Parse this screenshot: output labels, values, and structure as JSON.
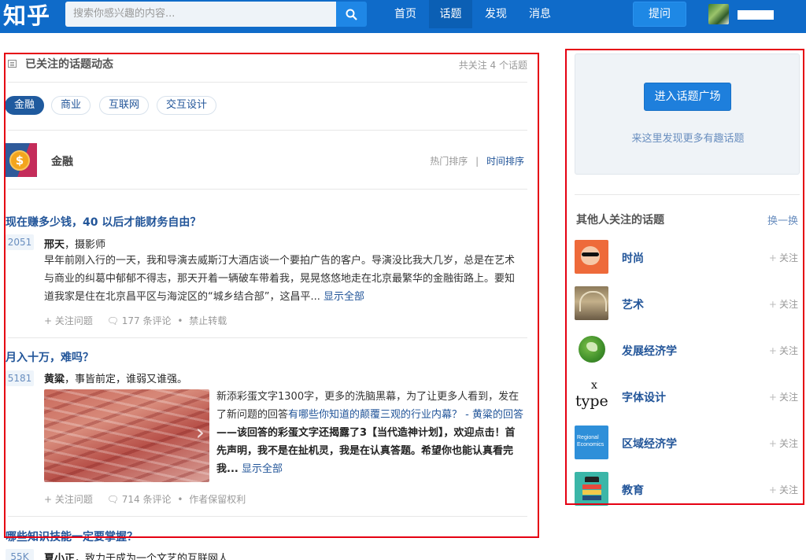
{
  "header": {
    "logo": "知乎",
    "search_placeholder": "搜索你感兴趣的内容...",
    "nav": [
      "首页",
      "话题",
      "发现",
      "消息"
    ],
    "active_nav": "话题",
    "ask_button": "提问"
  },
  "main": {
    "section_title": "已关注的话题动态",
    "followed_count": "共关注 4 个话题",
    "tags": [
      "金融",
      "商业",
      "互联网",
      "交互设计"
    ],
    "active_tag": "金融",
    "topic_name": "金融",
    "sort_hot": "热门排序",
    "sort_divider": "|",
    "sort_time": "时间排序",
    "feed": [
      {
        "title": "现在赚多少钱，40 以后才能财务自由？",
        "votes": "2051",
        "author_name": "邢天",
        "author_bio": "，摄影师",
        "body": "早年前刚入行的一天，我和导演去威斯汀大酒店谈一个要拍广告的客户。导演没比我大几岁，总是在艺术与商业的纠葛中郁郁不得志，那天开着一辆破车带着我，晃晃悠悠地走在北京最繁华的金融街路上。要知道我家是住在北京昌平区与海淀区的“城乡结合部”，这昌平...",
        "more": "显示全部",
        "meta_follow": "+ 关注问题",
        "meta_comments": "177 条评论",
        "meta_dot": "•",
        "meta_extra": "禁止转载"
      },
      {
        "title": "月入十万，难吗？",
        "votes": "5181",
        "author_name": "黄粱",
        "author_bio": "，事皆前定，谁弱又谁强。",
        "body_plain": "新添彩蛋文字1300字，更多的洗脑黑幕，为了让更多人看到，发在了新问题的回答",
        "body_link": "有哪些你知道的颠覆三观的行业内幕？ - 黄粱的回答",
        "body_bold": "——该回答的彩蛋文字还揭露了3【当代造神计划】，欢迎点击！首先声明，我不是在扯机灵，我是在认真答题。希望你也能认真看完我...",
        "more": "显示全部",
        "meta_follow": "+ 关注问题",
        "meta_comments": "714 条评论",
        "meta_dot": "•",
        "meta_extra": "作者保留权利"
      },
      {
        "title": "哪些知识技能一定要掌握？",
        "votes": "55K",
        "author_name": "夏小正",
        "author_bio": "，致力于成为一个文艺的互联网人"
      }
    ]
  },
  "sidebar": {
    "plaza_button": "进入话题广场",
    "plaza_tip": "来这里发现更多有趣话题",
    "others_title": "其他人关注的话题",
    "refresh": "换一换",
    "follow_label": "关注",
    "follow_plus": "+",
    "topics": [
      {
        "name": "时尚",
        "icon": "fashion-thumbnail"
      },
      {
        "name": "艺术",
        "icon": "art-thumbnail"
      },
      {
        "name": "发展经济学",
        "icon": "globe-thumbnail"
      },
      {
        "name": "字体设计",
        "icon": "typography-thumbnail"
      },
      {
        "name": "区域经济学",
        "icon": "regional-economics-thumbnail"
      },
      {
        "name": "教育",
        "icon": "education-thumbnail"
      }
    ],
    "type_thumb_text": "type",
    "type_thumb_mark": "x",
    "region_thumb_text": "Regional Economics"
  },
  "colors": {
    "topbar": "#0f6bc9",
    "link": "#225599",
    "highlight_border": "#e50012"
  }
}
